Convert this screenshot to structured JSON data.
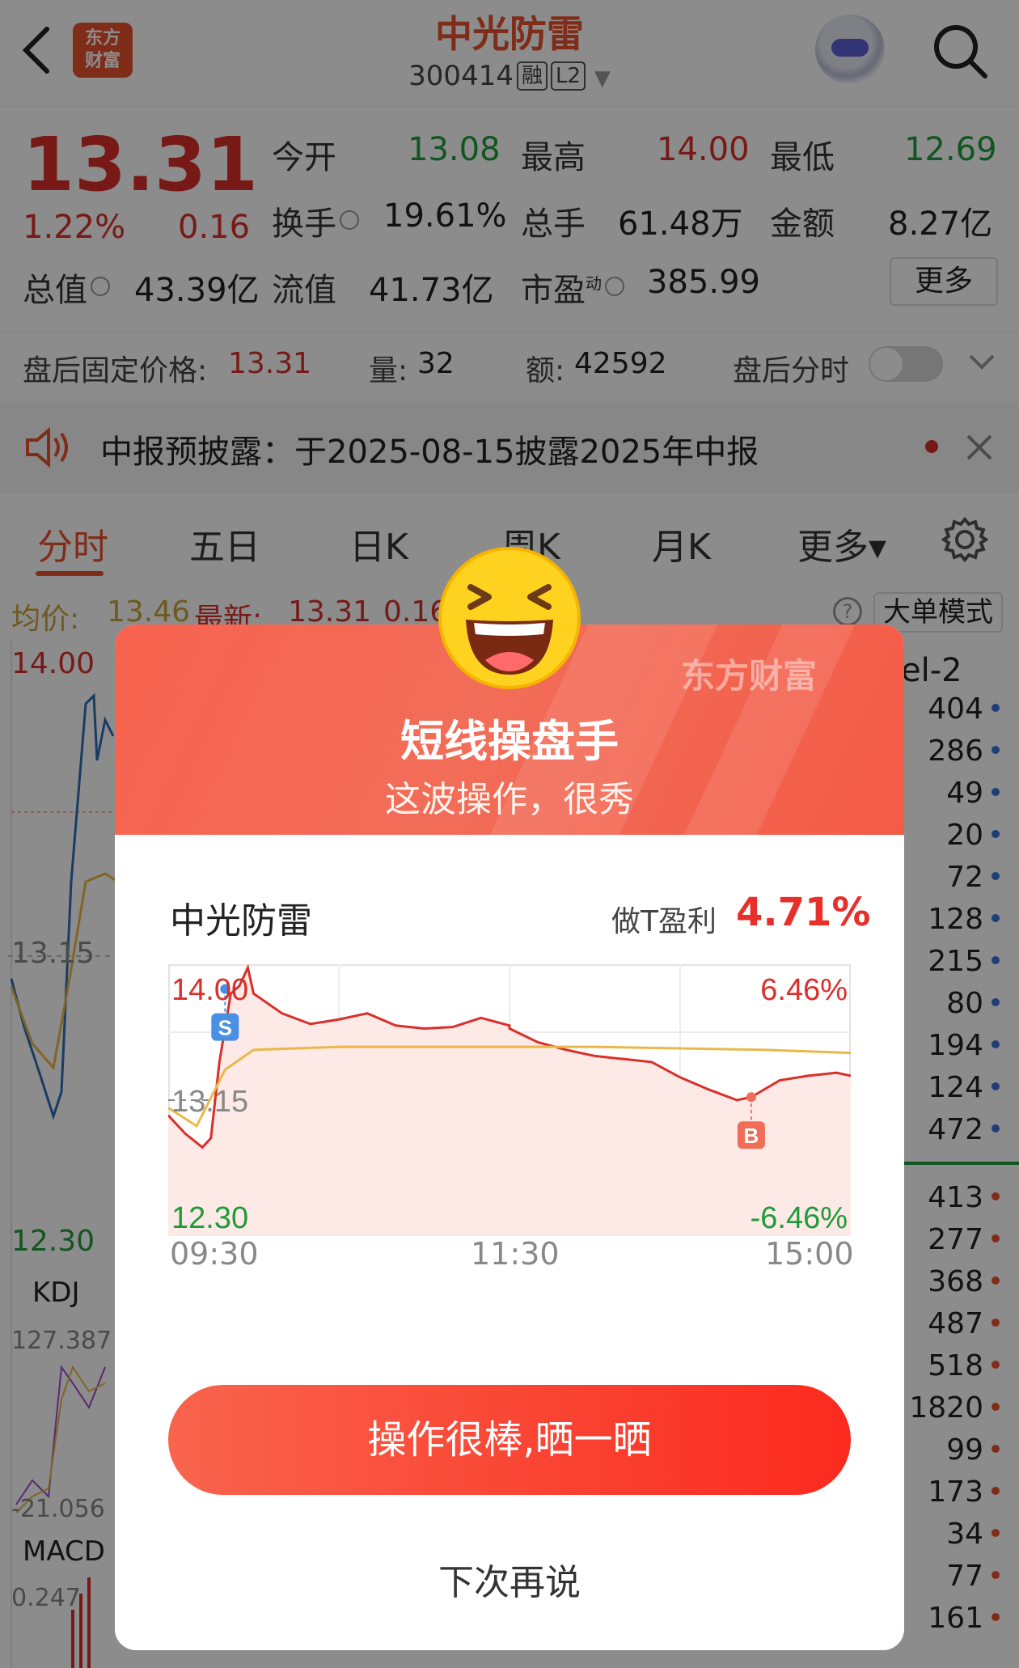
{
  "header": {
    "stock_name": "中光防雷",
    "stock_code": "300414",
    "tag_margin": "融",
    "tag_level": "L2",
    "logo_line1": "东方",
    "logo_line2": "财富"
  },
  "quote": {
    "price": "13.31",
    "change_pct": "1.22%",
    "change_amt": "0.16",
    "open_label": "今开",
    "open": "13.08",
    "high_label": "最高",
    "high": "14.00",
    "low_label": "最低",
    "low": "12.69",
    "turnover_label": "换手",
    "turnover": "19.61%",
    "volume_label": "总手",
    "volume": "61.48万",
    "amount_label": "金额",
    "amount": "8.27亿",
    "mktcap_label": "总值",
    "mktcap": "43.39亿",
    "float_label": "流值",
    "float": "41.73亿",
    "pe_label": "市盈",
    "pe_sup": "动",
    "pe": "385.99",
    "more_label": "更多"
  },
  "after_hours": {
    "price_label": "盘后固定价格:",
    "price": "13.31",
    "qty_label": "量:",
    "qty": "32",
    "amt_label": "额:",
    "amt": "42592",
    "intraday_label": "盘后分时"
  },
  "notice": {
    "text": "中报预披露：于2025-08-15披露2025年中报"
  },
  "tabs": [
    "分时",
    "五日",
    "日K",
    "周K",
    "月K",
    "更多▾"
  ],
  "infobar": {
    "avg_label": "均价:",
    "avg": "13.46",
    "latest_label": "最新:",
    "latest": "13.31",
    "chg": "0.16",
    "big_mode": "大单模式"
  },
  "background_chart": {
    "y_top": "14.00",
    "y_mid": "13.15",
    "y_bottom": "12.30",
    "kdj_label": "KDJ",
    "kdj_top": "127.387",
    "kdj_bottom": "-21.056",
    "macd_label": "MACD",
    "macd_top": "0.247",
    "level2_label": "el-2",
    "right_list_top": [
      "404",
      "286",
      "49",
      "20",
      "72",
      "128",
      "215",
      "80",
      "194",
      "124",
      "472"
    ],
    "right_list_bottom": [
      "413",
      "277",
      "368",
      "487",
      "518",
      "1820",
      "99",
      "173",
      "34",
      "77",
      "161"
    ]
  },
  "dialog": {
    "brand": "东方财富",
    "title": "短线操盘手",
    "subtitle": "这波操作，很秀",
    "stock_name": "中光防雷",
    "profit_label": "做T盈利",
    "profit_value": "4.71%",
    "share_button": "操作很棒,晒一晒",
    "later_button": "下次再说",
    "colors": {
      "price_line": "#d9302b",
      "avg_line": "#e8b94a",
      "fill": "#fde9e6",
      "buy_marker": "#f26d58",
      "sell_marker": "#4a90e2"
    }
  },
  "chart_data": {
    "type": "line",
    "x_ticks": [
      "09:30",
      "11:30",
      "15:00"
    ],
    "y_left_ticks": [
      "14.00",
      "13.15",
      "12.30"
    ],
    "y_right_ticks": [
      "6.46%",
      "-6.46%"
    ],
    "ylim": [
      12.3,
      14.0
    ],
    "prev_close": 13.15,
    "markers": [
      {
        "label": "S",
        "time": "09:50",
        "price": 13.88
      },
      {
        "label": "B",
        "time": "14:25",
        "price": 13.17
      }
    ],
    "series": [
      {
        "x": [
          "09:30",
          "09:36",
          "09:42",
          "09:45",
          "09:48",
          "09:52",
          "09:55",
          "09:58",
          "10:00",
          "10:10",
          "10:20",
          "10:30",
          "10:40",
          "10:50",
          "11:00",
          "11:10",
          "11:20",
          "11:30",
          "13:00",
          "13:10",
          "13:20",
          "13:30",
          "13:40",
          "13:50",
          "14:00",
          "14:10",
          "14:20",
          "14:25",
          "14:35",
          "14:45",
          "14:55",
          "15:00"
        ],
        "values": [
          13.05,
          12.93,
          12.84,
          12.9,
          13.4,
          13.85,
          13.9,
          14.02,
          13.85,
          13.72,
          13.65,
          13.68,
          13.72,
          13.64,
          13.62,
          13.63,
          13.69,
          13.64,
          13.62,
          13.53,
          13.48,
          13.44,
          13.42,
          13.4,
          13.3,
          13.22,
          13.15,
          13.17,
          13.28,
          13.31,
          13.33,
          13.31
        ]
      },
      {
        "x": [
          "09:30",
          "09:40",
          "09:50",
          "10:00",
          "10:30",
          "11:30",
          "13:30",
          "14:30",
          "15:00"
        ],
        "values": [
          13.1,
          12.98,
          13.35,
          13.48,
          13.5,
          13.5,
          13.5,
          13.48,
          13.46
        ]
      }
    ]
  }
}
